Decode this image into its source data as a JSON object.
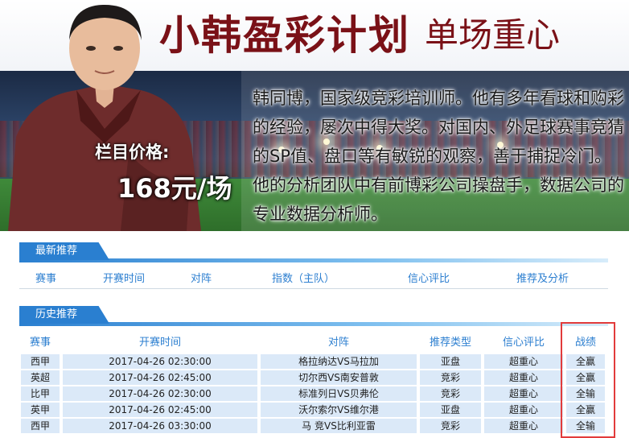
{
  "banner": {
    "title_main": "小韩盈彩计划",
    "title_sub": "单场重心",
    "price_label": "栏目价格:",
    "price_value": "168元/场",
    "intro": "韩同博，国家级竞彩培训师。他有多年看球和购彩的经验，屡次中得大奖。对国内、外足球赛事竞猜的SP值、盘口等有敏锐的观察，善于捕捉冷门。 他的分析团队中有前博彩公司操盘手，数据公司的专业数据分析师。"
  },
  "latest": {
    "tab_label": "最新推荐",
    "columns": [
      "赛事",
      "开赛时间",
      "对阵",
      "指数（主队）",
      "信心评比",
      "推荐及分析"
    ]
  },
  "history": {
    "tab_label": "历史推荐",
    "columns": [
      "赛事",
      "开赛时间",
      "对阵",
      "推荐类型",
      "信心评比",
      "战绩"
    ],
    "rows": [
      {
        "league": "西甲",
        "time": "2017-04-26 02:30:00",
        "match": "格拉纳达VS马拉加",
        "type": "亚盘",
        "confidence": "超重心",
        "result": "全赢"
      },
      {
        "league": "英超",
        "time": "2017-04-26 02:45:00",
        "match": "切尔西VS南安普敦",
        "type": "竞彩",
        "confidence": "超重心",
        "result": "全赢"
      },
      {
        "league": "比甲",
        "time": "2017-04-26 02:30:00",
        "match": "标准列日VS贝弗伦",
        "type": "竞彩",
        "confidence": "超重心",
        "result": "全输"
      },
      {
        "league": "英甲",
        "time": "2017-04-26 02:45:00",
        "match": "沃尔索尔VS维尔港",
        "type": "亚盘",
        "confidence": "超重心",
        "result": "全赢"
      },
      {
        "league": "西甲",
        "time": "2017-04-26 03:30:00",
        "match": "马 竞VS比利亚雷",
        "type": "竞彩",
        "confidence": "超重心",
        "result": "全输"
      }
    ]
  },
  "colors": {
    "accent_blue": "#2a7fd0",
    "title_red": "#7a1117",
    "row_fill": "#dbe9f8",
    "highlight_red": "#e23b3b"
  }
}
